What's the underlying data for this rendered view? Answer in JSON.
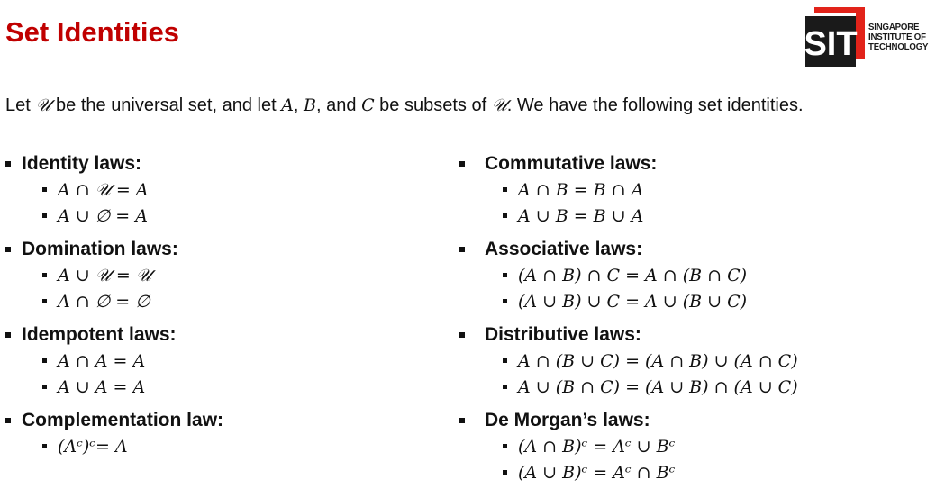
{
  "slide": {
    "title": "Set Identities",
    "logo": {
      "mark": "SIT",
      "line1": "SINGAPORE",
      "line2": "INSTITUTE OF",
      "line3": "TECHNOLOGY",
      "red": "#e2231a",
      "dark": "#1a1a1a"
    },
    "intro": {
      "t1": "Let ",
      "u1": "𝒰",
      "t2": " be the universal set, and let ",
      "a": "A",
      "t3": ", ",
      "b": "B",
      "t4": ", and ",
      "c": "C",
      "t5": " be subsets of ",
      "u2": "𝒰",
      "t6": ". We have the following set identities."
    },
    "left_groups": [
      {
        "heading": "Identity laws:",
        "laws": [
          "A ∩ 𝒰 = A",
          "A ∪ ∅ = A"
        ]
      },
      {
        "heading": "Domination laws:",
        "laws": [
          "A ∪ 𝒰 = 𝒰",
          "A ∩ ∅ = ∅"
        ]
      },
      {
        "heading": "Idempotent laws:",
        "laws": [
          "A ∩ A = A",
          "A ∪ A = A"
        ]
      },
      {
        "heading": "Complementation law:",
        "laws": [
          "(Aᶜ)ᶜ= A"
        ]
      }
    ],
    "right_groups": [
      {
        "heading": "Commutative laws:",
        "laws": [
          "A ∩ B = B ∩ A",
          "A ∪ B = B ∪ A"
        ]
      },
      {
        "heading": "Associative laws:",
        "laws": [
          "(A ∩ B) ∩ C = A ∩ (B ∩ C)",
          "(A ∪ B) ∪ C = A ∪ (B ∪ C)"
        ]
      },
      {
        "heading": "Distributive laws:",
        "laws": [
          "A ∩ (B ∪ C) = (A ∩ B) ∪ (A ∩ C)",
          "A ∪ (B ∩ C) = (A ∪ B) ∩ (A ∪ C)"
        ]
      },
      {
        "heading": "De Morgan’s laws:",
        "laws": [
          "(A ∩ B)ᶜ = Aᶜ ∪ Bᶜ",
          "(A ∪ B)ᶜ = Aᶜ ∩ Bᶜ"
        ]
      }
    ]
  }
}
